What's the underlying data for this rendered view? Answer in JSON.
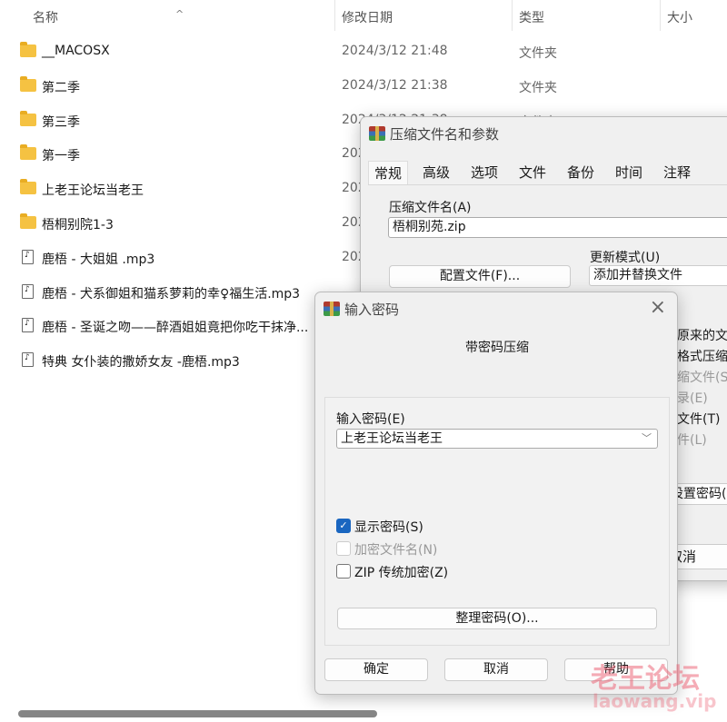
{
  "columns": {
    "name": "名称",
    "date": "修改日期",
    "type": "类型",
    "size": "大小"
  },
  "files": [
    {
      "name": "__MACOSX",
      "date": "2024/3/12 21:48",
      "type": "文件夹",
      "icon": "folder-icon"
    },
    {
      "name": "第二季",
      "date": "2024/3/12 21:38",
      "type": "文件夹",
      "icon": "folder-icon"
    },
    {
      "name": "第三季",
      "date": "2024/3/12 21:38",
      "type": "文件夹",
      "icon": "folder-icon"
    },
    {
      "name": "第一季",
      "date": "202",
      "type": "",
      "icon": "folder-icon"
    },
    {
      "name": "上老王论坛当老王",
      "date": "202",
      "type": "",
      "icon": "folder-icon"
    },
    {
      "name": "梧桐别院1-3",
      "date": "202",
      "type": "",
      "icon": "folder-icon"
    },
    {
      "name": "鹿梧 - 大姐姐 .mp3",
      "date": "202",
      "type": "",
      "icon": "audio-file-icon"
    },
    {
      "name": "鹿梧 - 犬系御姐和猫系萝莉的幸♀福生活.mp3",
      "date": "",
      "type": "",
      "icon": "audio-file-icon"
    },
    {
      "name": "鹿梧 - 圣诞之吻——醉酒姐姐竟把你吃干抹净...",
      "date": "",
      "type": "",
      "icon": "audio-file-icon"
    },
    {
      "name": "特典 女仆装的撒娇女友 -鹿梧.mp3",
      "date": "",
      "type": "",
      "icon": "audio-file-icon"
    }
  ],
  "archive_dialog": {
    "title": "压缩文件名和参数",
    "tabs": [
      "常规",
      "高级",
      "选项",
      "文件",
      "备份",
      "时间",
      "注释"
    ],
    "archive_name_label": "压缩文件名(A)",
    "archive_name": "梧桐别苑.zip",
    "profiles_button": "配置文件(F)...",
    "update_mode_label": "更新模式(U)",
    "update_mode": "添加并替换文件",
    "fragments": [
      "原来的文件",
      "格式压缩文",
      "缩文件(S)",
      "录(E)",
      "文件(T)",
      "件(L)"
    ],
    "set_password_button": "设置密码(P",
    "cancel_button": "取消"
  },
  "password_dialog": {
    "title": "输入密码",
    "subtitle": "带密码压缩",
    "password_label": "输入密码(E)",
    "password_value": "上老王论坛当老王",
    "show_password": {
      "label": "显示密码(S)",
      "checked": true
    },
    "encrypt_names": {
      "label": "加密文件名(N)",
      "checked": false,
      "disabled": true
    },
    "zip_legacy": {
      "label": "ZIP 传统加密(Z)",
      "checked": false
    },
    "organize_button": "整理密码(O)...",
    "ok_button": "确定",
    "cancel_button": "取消",
    "help_button": "帮助"
  },
  "watermark": {
    "text": "老王论坛",
    "url": "laowang.vip"
  }
}
